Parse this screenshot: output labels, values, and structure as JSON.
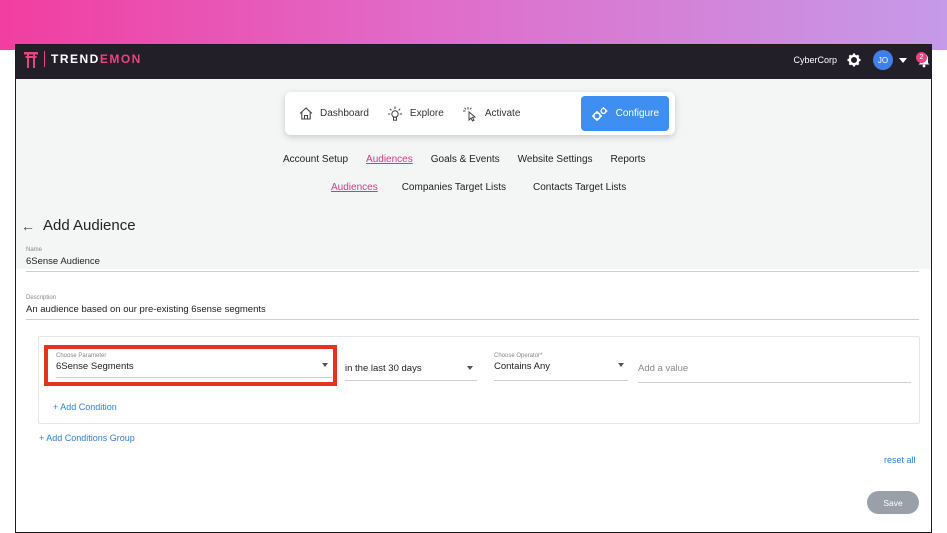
{
  "brand": {
    "prefix": "TREND",
    "accent": "EMON",
    "accent_color": "#e8457f"
  },
  "topbar": {
    "org_name": "CyberCorp",
    "avatar_initials": "JO",
    "notifications_count": "2"
  },
  "main_nav": [
    {
      "label": "Dashboard",
      "icon": "home-icon"
    },
    {
      "label": "Explore",
      "icon": "lightbulb-icon"
    },
    {
      "label": "Activate",
      "icon": "click-icon"
    },
    {
      "label": "Configure",
      "icon": "gears-icon",
      "active": true
    }
  ],
  "config_tabs": [
    {
      "label": "Account Setup"
    },
    {
      "label": "Audiences",
      "active": true
    },
    {
      "label": "Goals & Events"
    },
    {
      "label": "Website Settings"
    },
    {
      "label": "Reports"
    }
  ],
  "audience_tabs": [
    {
      "label": "Audiences",
      "active": true
    },
    {
      "label": "Companies Target Lists"
    },
    {
      "label": "Contacts Target Lists"
    }
  ],
  "page": {
    "back_arrow": "←",
    "title": "Add Audience"
  },
  "form": {
    "name_label": "Name",
    "name_value": "6Sense Audience",
    "description_label": "Description",
    "description_value": "An audience based on our pre-existing 6sense segments"
  },
  "condition": {
    "parameter_label": "Choose Parameter",
    "parameter_value": "6Sense Segments",
    "timeframe_value": "in the last 30 days",
    "operator_label": "Choose Operator*",
    "operator_value": "Contains Any",
    "value_placeholder": "Add a value"
  },
  "actions": {
    "add_condition": "+ Add Condition",
    "add_group": "+ Add Conditions Group",
    "reset_all": "reset all",
    "save": "Save"
  },
  "colors": {
    "primary": "#3f8ef2",
    "accent": "#d33a86",
    "highlight": "#e2341f",
    "topbar": "#231f29"
  }
}
